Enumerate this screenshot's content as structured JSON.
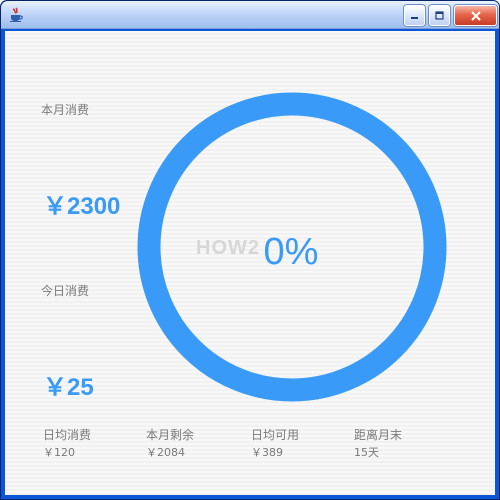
{
  "window": {
    "titlebar_buttons": {
      "minimize": "minimize-icon",
      "maximize": "maximize-icon",
      "close": "close-icon"
    }
  },
  "dashboard": {
    "monthly_spending_label": "本月消费",
    "monthly_spending_value": "￥2300",
    "today_spending_label": "今日消费",
    "today_spending_value": "￥25",
    "gauge_watermark": "HOW2",
    "progress_text": "0%",
    "progress_value": 0,
    "accent_color": "#3a9af7"
  },
  "stats": [
    {
      "label": "日均消费",
      "value": "￥120"
    },
    {
      "label": "本月剩余",
      "value": "￥2084"
    },
    {
      "label": "日均可用",
      "value": "￥389"
    },
    {
      "label": "距离月末",
      "value": "15天"
    }
  ]
}
